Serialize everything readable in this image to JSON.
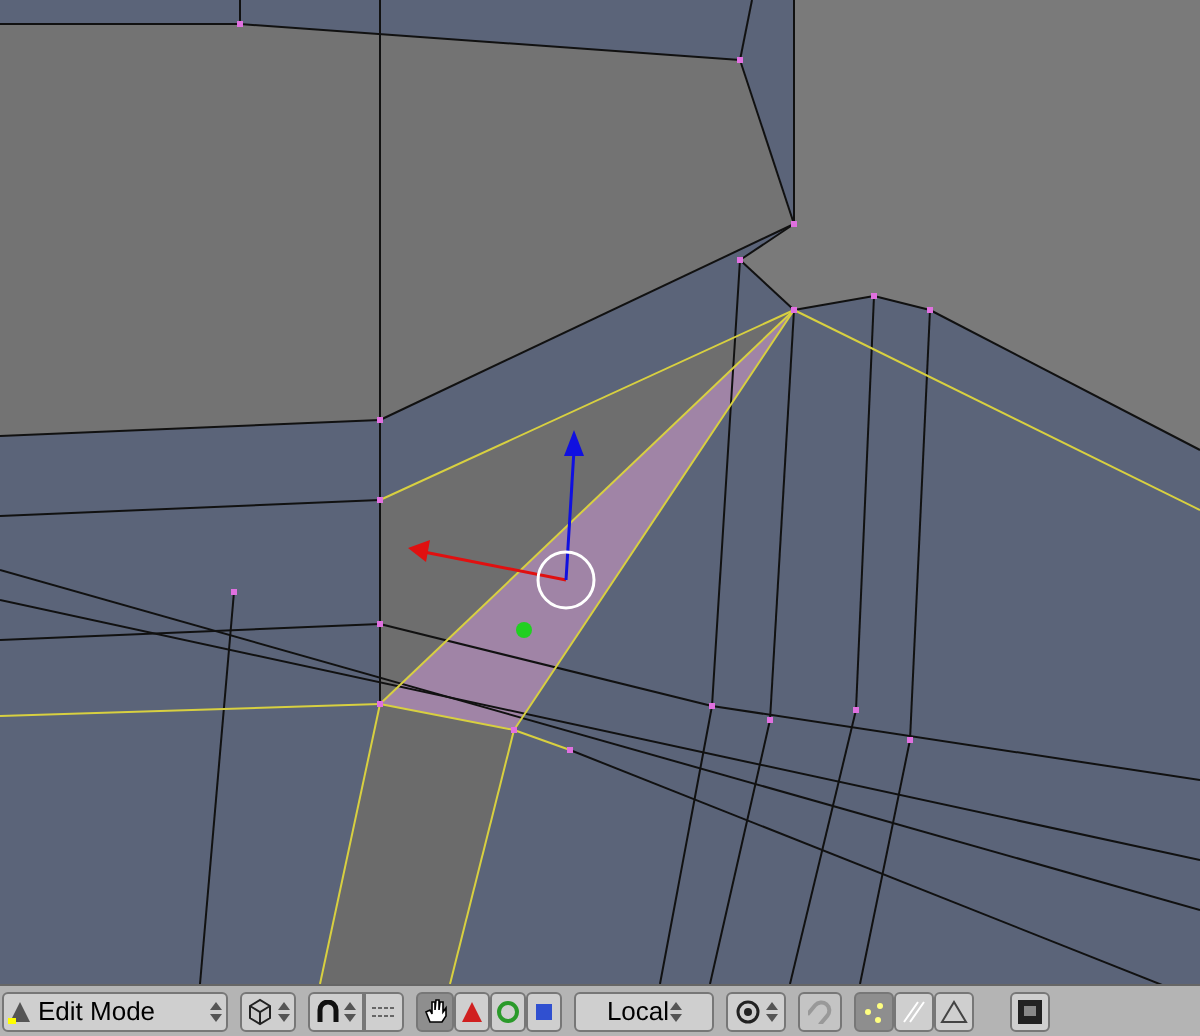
{
  "header": {
    "mode": {
      "label": "Edit Mode"
    },
    "manipulator": {
      "on": true
    },
    "orientation": {
      "label": "Local"
    },
    "select_modes": [
      {
        "kind": "vertex",
        "selected": true
      },
      {
        "kind": "edge",
        "selected": false
      },
      {
        "kind": "face",
        "selected": false
      }
    ]
  }
}
